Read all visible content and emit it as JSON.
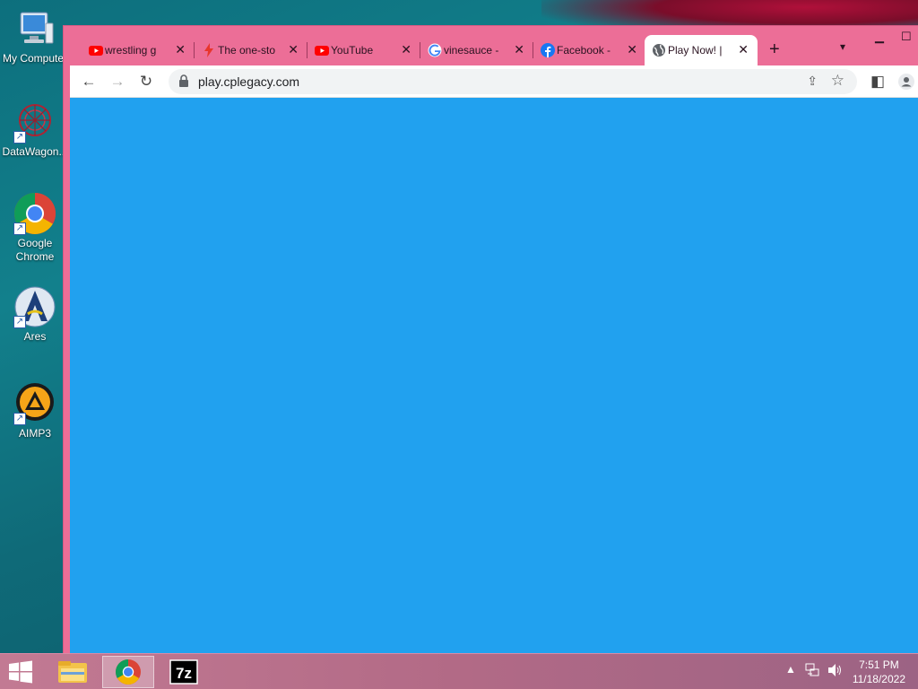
{
  "desktop": {
    "icons": [
      {
        "label": "My Computer",
        "icon": "computer-icon"
      },
      {
        "label": "DataWagon...",
        "icon": "datawagon-icon"
      },
      {
        "label": "Google Chrome",
        "icon": "chrome-icon"
      },
      {
        "label": "Ares",
        "icon": "ares-icon"
      },
      {
        "label": "AIMP3",
        "icon": "aimp-icon"
      }
    ]
  },
  "browser": {
    "tabs": [
      {
        "title": "wrestling g",
        "icon": "youtube-icon",
        "active": false
      },
      {
        "title": "The one-sto",
        "icon": "bolt-icon",
        "active": false
      },
      {
        "title": "YouTube",
        "icon": "youtube-icon",
        "active": false
      },
      {
        "title": "vinesauce -",
        "icon": "google-icon",
        "active": false
      },
      {
        "title": "Facebook -",
        "icon": "facebook-icon",
        "active": false
      },
      {
        "title": "Play Now! |",
        "icon": "globe-icon",
        "active": true
      }
    ],
    "url": "play.cplegacy.com",
    "content_color": "#21a1ef"
  },
  "taskbar": {
    "apps": [
      {
        "name": "File Explorer",
        "icon": "folder-icon",
        "active": false
      },
      {
        "name": "Google Chrome",
        "icon": "chrome-icon",
        "active": true
      },
      {
        "name": "7-Zip",
        "icon": "7zip-icon",
        "active": false
      }
    ],
    "time": "7:51 PM",
    "date": "11/18/2022"
  }
}
